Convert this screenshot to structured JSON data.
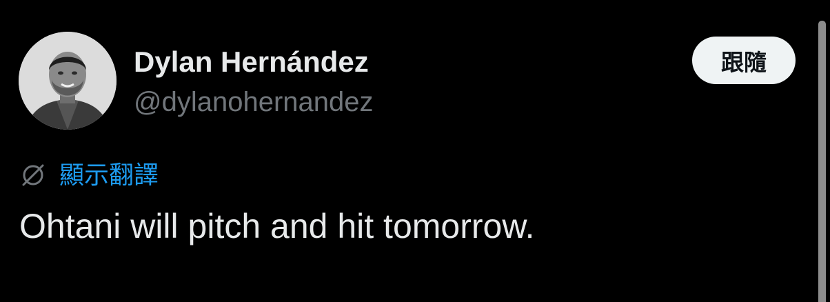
{
  "author": {
    "display_name": "Dylan Hernández",
    "handle": "@dylanohernandez",
    "avatar_icon": "profile-photo"
  },
  "follow_button": {
    "label": "跟隨"
  },
  "translate": {
    "icon": "globe-translate-icon",
    "label": "顯示翻譯",
    "color": "#1d9bf0"
  },
  "tweet": {
    "text": "Ohtani will pitch and hit tomorrow."
  },
  "colors": {
    "background": "#000000",
    "primary_text": "#e7e9ea",
    "secondary_text": "#71767b",
    "follow_button_bg": "#eff3f4"
  }
}
